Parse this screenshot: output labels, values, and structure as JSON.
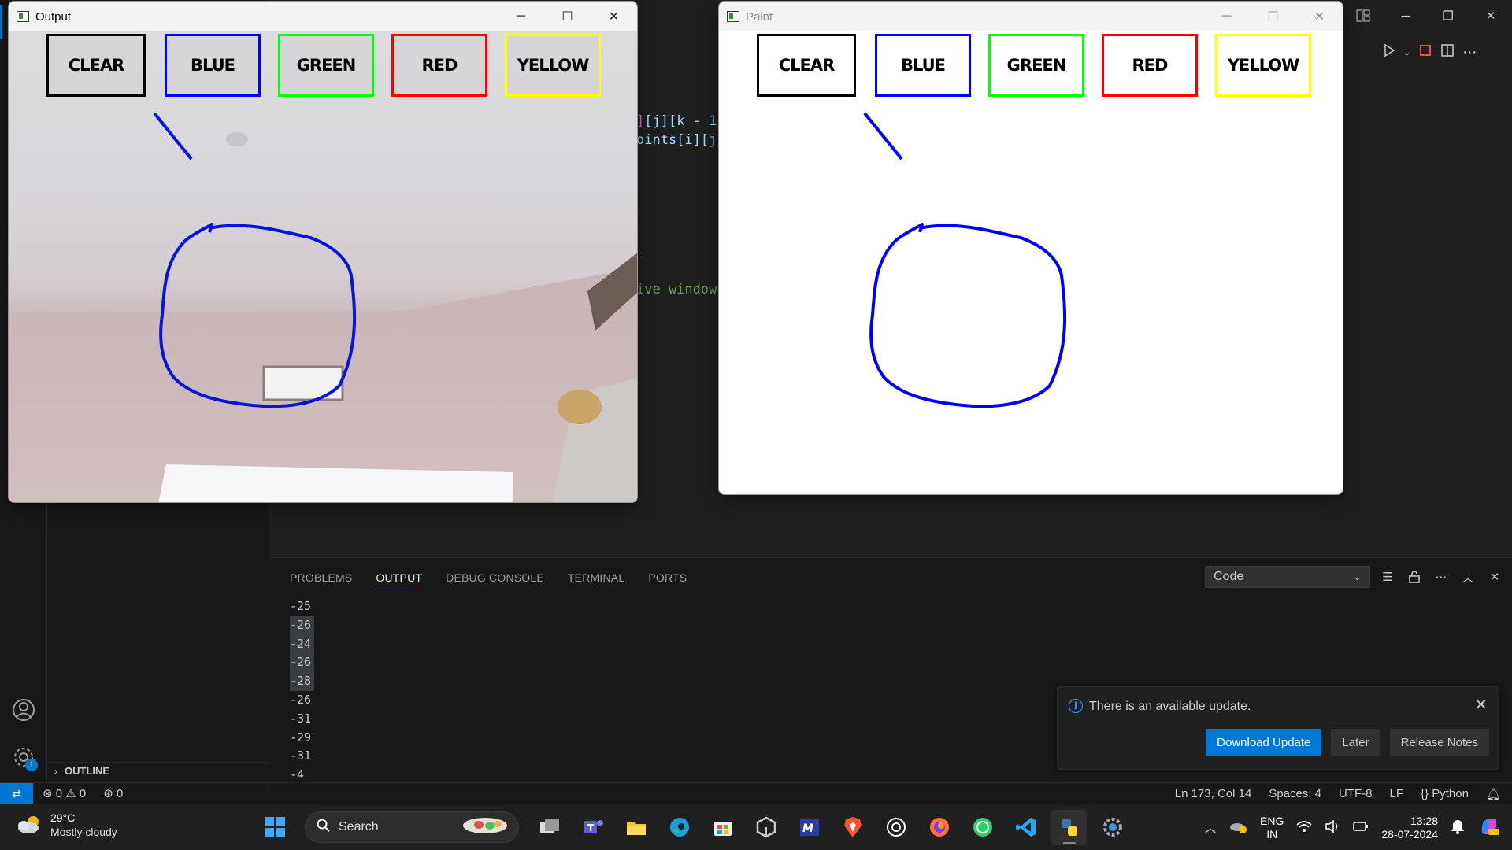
{
  "vscode": {
    "code_fragments": [
      "[j][k - 1",
      "oints[i][j]",
      "ive window"
    ],
    "panel_tabs": [
      "PROBLEMS",
      "OUTPUT",
      "DEBUG CONSOLE",
      "TERMINAL",
      "PORTS"
    ],
    "active_tab": "OUTPUT",
    "channel": "Code",
    "output_lines": [
      "-25",
      "-26",
      "-24",
      "-26",
      "-28",
      "-26",
      "-31",
      "-29",
      "-31",
      "-4"
    ],
    "outline_label": "OUTLINE",
    "settings_badge": "1",
    "status": {
      "errors": "0",
      "warnings": "0",
      "ports": "0",
      "position": "Ln 173, Col 14",
      "spaces": "Spaces: 4",
      "encoding": "UTF-8",
      "eol": "LF",
      "language": "Python"
    },
    "notification": {
      "message": "There is an available update.",
      "primary": "Download Update",
      "later": "Later",
      "notes": "Release Notes"
    }
  },
  "output_window": {
    "title": "Output",
    "buttons": [
      {
        "label": "CLEAR",
        "color": "#000000"
      },
      {
        "label": "BLUE",
        "color": "#0000ff"
      },
      {
        "label": "GREEN",
        "color": "#00ff00"
      },
      {
        "label": "RED",
        "color": "#ff0000"
      },
      {
        "label": "YELLOW",
        "color": "#ffff00"
      }
    ]
  },
  "paint_window": {
    "title": "Paint",
    "buttons": [
      {
        "label": "CLEAR",
        "color": "#000000"
      },
      {
        "label": "BLUE",
        "color": "#0000ff"
      },
      {
        "label": "GREEN",
        "color": "#00ff00"
      },
      {
        "label": "RED",
        "color": "#ff0000"
      },
      {
        "label": "YELLOW",
        "color": "#ffff00"
      }
    ],
    "stroke_color": "#0000ff"
  },
  "taskbar": {
    "weather_temp": "29°C",
    "weather_condition": "Mostly cloudy",
    "search_placeholder": "Search",
    "apps": [
      "task-view-icon",
      "teams-icon",
      "file-explorer-icon",
      "edge-icon",
      "store-icon",
      "unity-icon",
      "maple-icon",
      "brave-icon",
      "chatgpt-icon",
      "firefox-icon",
      "whatsapp-icon",
      "vscode-icon",
      "python-icon",
      "settings-icon"
    ],
    "lang_top": "ENG",
    "lang_bottom": "IN",
    "time": "13:28",
    "date": "28-07-2024"
  }
}
